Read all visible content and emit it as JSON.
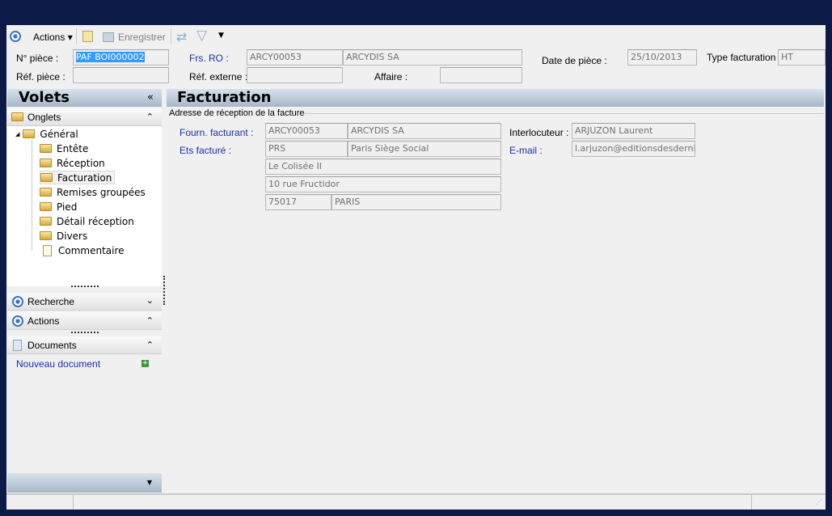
{
  "toolbar": {
    "actions_label": "Actions",
    "save_label": "Enregistrer"
  },
  "header": {
    "piece_label": "N° pièce :",
    "piece_value": "PAF BOI000002",
    "ref_piece_label": "Réf. pièce :",
    "ref_piece_value": "",
    "frs_label": "Frs. RO :",
    "frs_code": "ARCY00053",
    "frs_name": "ARCYDIS SA",
    "ref_ext_label": "Réf. externe :",
    "ref_ext_value": "",
    "affaire_label": "Affaire :",
    "affaire_value": "",
    "date_label": "Date de pièce :",
    "date_value": "25/10/2013",
    "type_label": "Type facturation :",
    "type_value": "HT"
  },
  "sidebar": {
    "title": "Volets",
    "collapse": "«",
    "onglets": "Onglets",
    "tree": {
      "root": "Général",
      "items": [
        "Entête",
        "Réception",
        "Facturation",
        "Remises groupées",
        "Pied",
        "Détail réception",
        "Divers",
        "Commentaire"
      ]
    },
    "recherche": "Recherche",
    "actions": "Actions",
    "documents": "Documents",
    "new_doc": "Nouveau document"
  },
  "main": {
    "title": "Facturation",
    "group": "Adresse de réception de la facture",
    "fourn_label": "Fourn. facturant :",
    "fourn_code": "ARCY00053",
    "fourn_name": "ARCYDIS SA",
    "ets_label": "Ets facturé :",
    "ets_code": "PRS",
    "ets_name": "Paris Siège Social",
    "addr1": "Le Colisée II",
    "addr2": "10 rue Fructidor",
    "cp": "75017",
    "ville": "PARIS",
    "interlocuteur_label": "Interlocuteur :",
    "interlocuteur_value": "ARJUZON Laurent",
    "email_label": "E-mail :",
    "email_value": "l.arjuzon@editionsdesdernie"
  }
}
